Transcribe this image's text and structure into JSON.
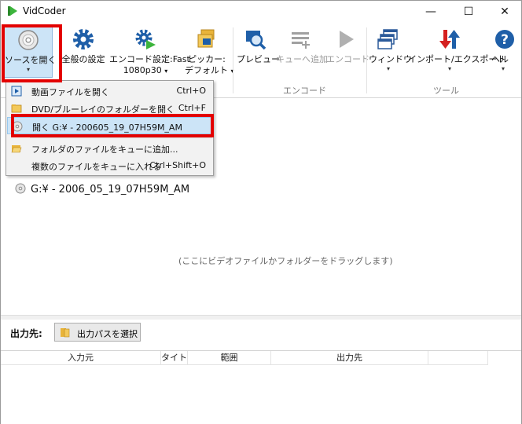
{
  "window": {
    "title": "VidCoder",
    "minimize": "—",
    "maximize": "☐",
    "close": "✕"
  },
  "ribbon": {
    "open_source": "ソースを開く",
    "general_settings": "全般の設定",
    "encode_settings_line1": "エンコード設定:Fast",
    "encode_settings_line2": "1080p30",
    "picker_line1": "ピッカー:",
    "picker_line2": "デフォルト",
    "preview": "プレビュー",
    "add_to_queue": "キューへ追加",
    "encode": "エンコード",
    "window": "ウィンドウ",
    "import_export": "インポート/エクスポート",
    "help": "ヘル",
    "group_encode": "エンコード",
    "group_tools": "ツール",
    "caret": "▾"
  },
  "menu": {
    "items": [
      {
        "label": "動画ファイルを開く",
        "shortcut": "Ctrl+O",
        "icon": "video-file-icon"
      },
      {
        "label": "DVD/ブルーレイのフォルダーを開く",
        "shortcut": "Ctrl+F",
        "icon": "folder-icon"
      },
      {
        "label": "開く G:¥ - 200605_19_07H59M_AM",
        "shortcut": "",
        "icon": "disc-icon"
      },
      {
        "label": "フォルダのファイルをキューに追加...",
        "shortcut": "",
        "icon": "folder-open-icon"
      },
      {
        "label": "複数のファイルをキューに入れる",
        "shortcut": "Ctrl+Shift+O",
        "icon": ""
      }
    ]
  },
  "main": {
    "source_item": "G:¥ - 2006_05_19_07H59M_AM",
    "drop_hint": "(ここにビデオファイルかフォルダーをドラッグします)"
  },
  "output": {
    "label": "出力先:",
    "choose_button": "出力パスを選択"
  },
  "queue": {
    "columns": [
      "入力元",
      "タイトル",
      "範囲",
      "出力先",
      ""
    ]
  },
  "colors": {
    "highlight_red": "#e30000",
    "selection_blue": "#cce4f7",
    "accent_blue": "#1f6fcf"
  }
}
